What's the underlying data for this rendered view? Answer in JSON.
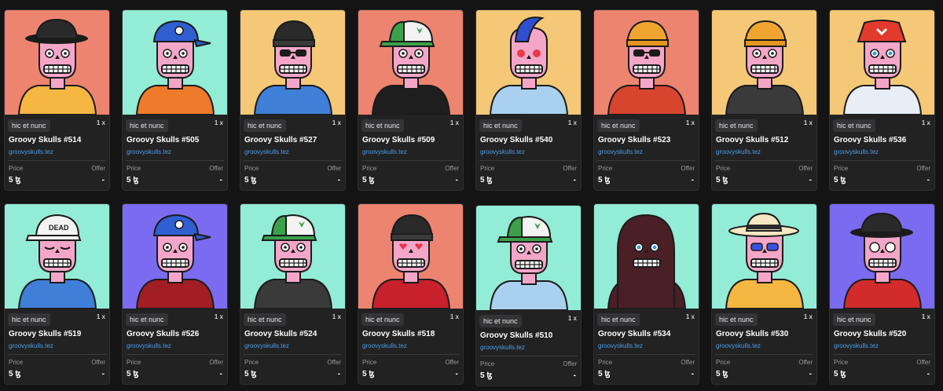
{
  "colors": {
    "salmon": "#ec8470",
    "mint": "#93ecd5",
    "gold": "#f4c877",
    "purple": "#7b6bf0",
    "creator_link": "#4c9ee8"
  },
  "cards": [
    {
      "title": "Groovy Skulls #514",
      "platform": "hic et nunc",
      "edition": "1 x",
      "creator": "groovyskulls.tez",
      "price_label": "Price",
      "offer_label": "Offer",
      "price": "5 ꜩ",
      "offer": "-",
      "bg": "#ec8470",
      "hat": "fedora-black",
      "shirt": "#f5b642",
      "eyes": "plain"
    },
    {
      "title": "Groovy Skulls #505",
      "platform": "hic et nunc",
      "edition": "1 x",
      "creator": "groovyskulls.tez",
      "price_label": "Price",
      "offer_label": "Offer",
      "price": "5 ꜩ",
      "offer": "-",
      "bg": "#93ecd5",
      "hat": "cap-blue",
      "shirt": "#f07a2b",
      "eyes": "plain"
    },
    {
      "title": "Groovy Skulls #527",
      "platform": "hic et nunc",
      "edition": "1 x",
      "creator": "groovyskulls.tez",
      "price_label": "Price",
      "offer_label": "Offer",
      "price": "5 ꜩ",
      "offer": "-",
      "bg": "#f4c877",
      "hat": "beanie-black",
      "shirt": "#3f7fd8",
      "eyes": "shades"
    },
    {
      "title": "Groovy Skulls #509",
      "platform": "hic et nunc",
      "edition": "1 x",
      "creator": "groovyskulls.tez",
      "price_label": "Price",
      "offer_label": "Offer",
      "price": "5 ꜩ",
      "offer": "-",
      "bg": "#ec8470",
      "hat": "cap-green",
      "shirt": "#1e1e1e",
      "eyes": "plain"
    },
    {
      "title": "Groovy Skulls #540",
      "platform": "hic et nunc",
      "edition": "1 x",
      "creator": "groovyskulls.tez",
      "price_label": "Price",
      "offer_label": "Offer",
      "price": "5 ꜩ",
      "offer": "-",
      "bg": "#f4c877",
      "hat": "mohawk",
      "shirt": "#a9d0ee",
      "eyes": "red"
    },
    {
      "title": "Groovy Skulls #523",
      "platform": "hic et nunc",
      "edition": "1 x",
      "creator": "groovyskulls.tez",
      "price_label": "Price",
      "offer_label": "Offer",
      "price": "5 ꜩ",
      "offer": "-",
      "bg": "#ec8470",
      "hat": "beanie-gold",
      "shirt": "#d8452f",
      "eyes": "shades"
    },
    {
      "title": "Groovy Skulls #512",
      "platform": "hic et nunc",
      "edition": "1 x",
      "creator": "groovyskulls.tez",
      "price_label": "Price",
      "offer_label": "Offer",
      "price": "5 ꜩ",
      "offer": "-",
      "bg": "#f4c877",
      "hat": "beanie-gold",
      "shirt": "#3a3a3a",
      "eyes": "plain"
    },
    {
      "title": "Groovy Skulls #536",
      "platform": "hic et nunc",
      "edition": "1 x",
      "creator": "groovyskulls.tez",
      "price_label": "Price",
      "offer_label": "Offer",
      "price": "5 ꜩ",
      "offer": "-",
      "bg": "#f4c877",
      "hat": "bucket-red",
      "shirt": "#e8eef5",
      "eyes": "blue"
    },
    {
      "title": "Groovy Skulls #519",
      "platform": "hic et nunc",
      "edition": "1 x",
      "creator": "groovyskulls.tez",
      "price_label": "Price",
      "offer_label": "Offer",
      "price": "5 ꜩ",
      "offer": "-",
      "bg": "#93ecd5",
      "hat": "cap-dead",
      "shirt": "#3f7fd8",
      "eyes": "closed"
    },
    {
      "title": "Groovy Skulls #526",
      "platform": "hic et nunc",
      "edition": "1 x",
      "creator": "groovyskulls.tez",
      "price_label": "Price",
      "offer_label": "Offer",
      "price": "5 ꜩ",
      "offer": "-",
      "bg": "#7b6bf0",
      "hat": "cap-blue",
      "shirt": "#a21d24",
      "eyes": "plain"
    },
    {
      "title": "Groovy Skulls #524",
      "platform": "hic et nunc",
      "edition": "1 x",
      "creator": "groovyskulls.tez",
      "price_label": "Price",
      "offer_label": "Offer",
      "price": "5 ꜩ",
      "offer": "-",
      "bg": "#93ecd5",
      "hat": "cap-green",
      "shirt": "#3a3a3a",
      "eyes": "plain"
    },
    {
      "title": "Groovy Skulls #518",
      "platform": "hic et nunc",
      "edition": "1 x",
      "creator": "groovyskulls.tez",
      "price_label": "Price",
      "offer_label": "Offer",
      "price": "5 ꜩ",
      "offer": "-",
      "bg": "#ec8470",
      "hat": "beanie-black",
      "shirt": "#c8212b",
      "eyes": "hearts"
    },
    {
      "title": "Groovy Skulls #510",
      "platform": "hic et nunc",
      "edition": "1 x",
      "creator": "groovyskulls.tez",
      "price_label": "Price",
      "offer_label": "Offer",
      "price": "5 ꜩ",
      "offer": "-",
      "bg": "#93ecd5",
      "hat": "cap-green",
      "shirt": "#a9d0ee",
      "eyes": "plain"
    },
    {
      "title": "Groovy Skulls #534",
      "platform": "hic et nunc",
      "edition": "1 x",
      "creator": "groovyskulls.tez",
      "price_label": "Price",
      "offer_label": "Offer",
      "price": "5 ꜩ",
      "offer": "-",
      "bg": "#93ecd5",
      "hat": "hood",
      "shirt": "#4a1f26",
      "eyes": "blue"
    },
    {
      "title": "Groovy Skulls #530",
      "platform": "hic et nunc",
      "edition": "1 x",
      "creator": "groovyskulls.tez",
      "price_label": "Price",
      "offer_label": "Offer",
      "price": "5 ꜩ",
      "offer": "-",
      "bg": "#93ecd5",
      "hat": "panama",
      "shirt": "#f5b642",
      "eyes": "shades-blue"
    },
    {
      "title": "Groovy Skulls #520",
      "platform": "hic et nunc",
      "edition": "1 x",
      "creator": "groovyskulls.tez",
      "price_label": "Price",
      "offer_label": "Offer",
      "price": "5 ꜩ",
      "offer": "-",
      "bg": "#7b6bf0",
      "hat": "fedora-black",
      "shirt": "#d22b2b",
      "eyes": "tez"
    }
  ]
}
